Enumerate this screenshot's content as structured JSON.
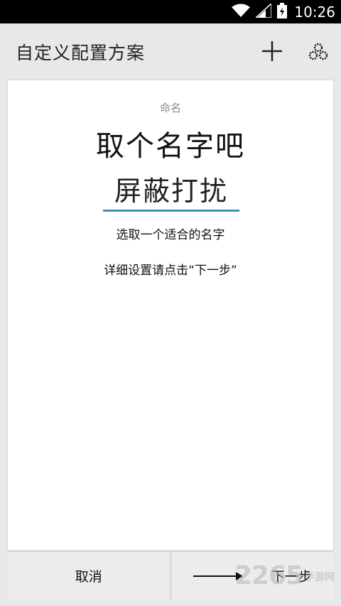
{
  "status_bar": {
    "time": "10:26",
    "icons": [
      "wifi-icon",
      "signal-icon",
      "battery-icon"
    ]
  },
  "action_bar": {
    "title": "自定义配置方案",
    "icons": [
      "add-icon",
      "gears-icon"
    ]
  },
  "card": {
    "label": "命名",
    "heading": "取个名字吧",
    "name_value": "屏蔽打扰",
    "hint": "选取一个适合的名字",
    "detail_hint": "详细设置请点击“下一步”"
  },
  "bottom": {
    "cancel_label": "取消",
    "next_label": "下一步"
  },
  "watermark": {
    "text": "2265",
    "sub": "手游网"
  },
  "colors": {
    "accent": "#3d8fbf",
    "background": "#e8e8e8",
    "card": "#ffffff",
    "status_bar": "#000000"
  }
}
